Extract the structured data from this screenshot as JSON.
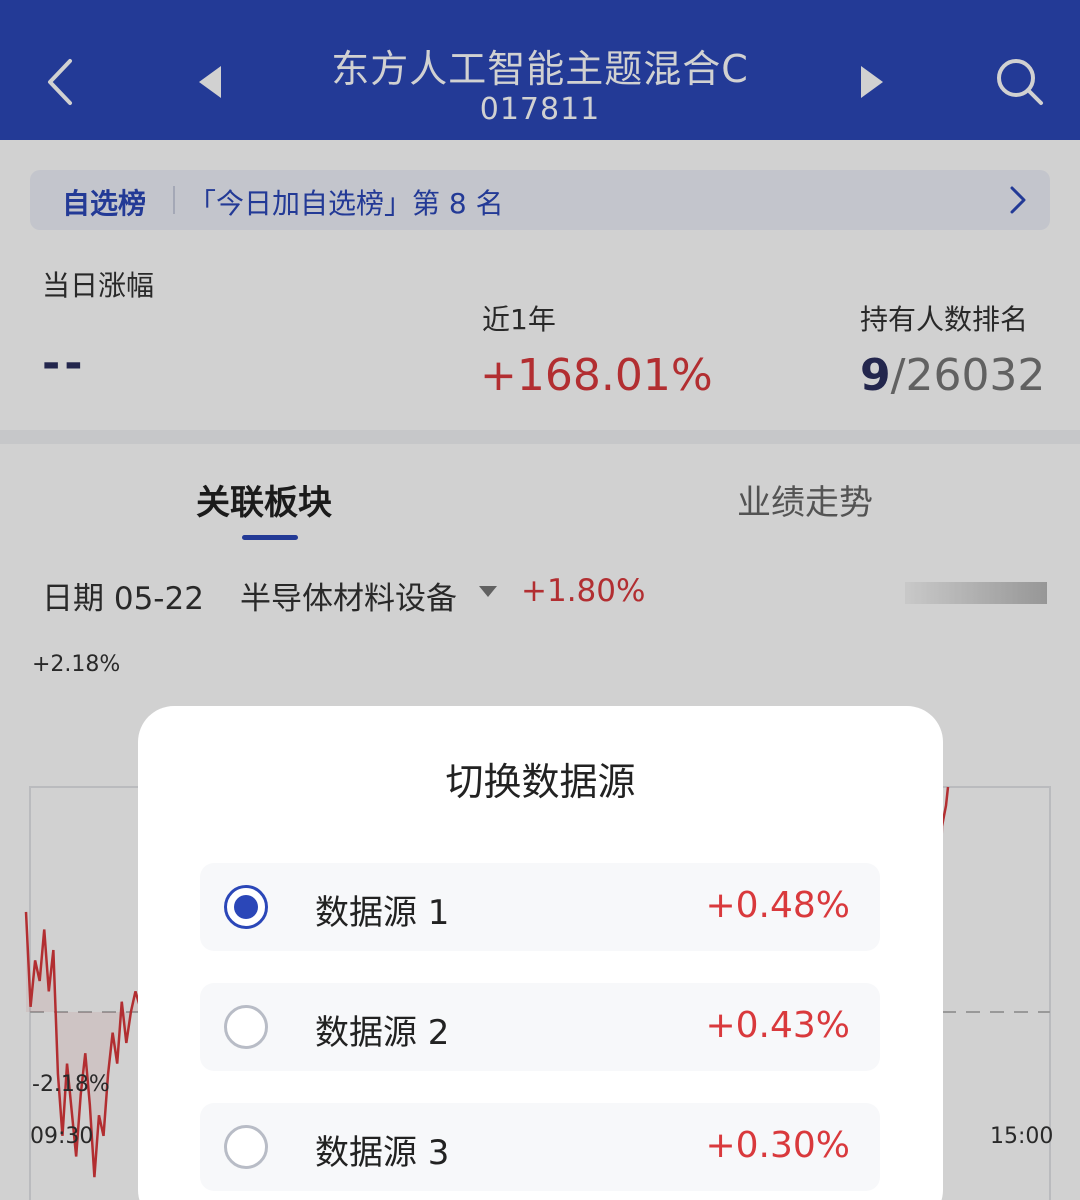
{
  "header": {
    "title": "东方人工智能主题混合C",
    "code": "017811"
  },
  "watchlist": {
    "tag": "自选榜",
    "text": "「今日加自选榜」第 8 名"
  },
  "stats": {
    "daily_label": "当日涨幅",
    "daily_value": "--",
    "year_label": "近1年",
    "year_value": "+168.01%",
    "rank_label": "持有人数排名",
    "rank_value": "9",
    "rank_total": "/26032"
  },
  "tabs": [
    {
      "label": "关联板块",
      "active": true
    },
    {
      "label": "业绩走势",
      "active": false
    }
  ],
  "filter": {
    "date": "日期 05-22",
    "sector": "半导体材料设备",
    "change": "+1.80%"
  },
  "chart_data": {
    "type": "line",
    "y_top_label": "+2.18%",
    "y_bottom_label": "-2.18%",
    "x_start_label": "09:30",
    "x_end_label": "15:00",
    "ylim": [
      -2.18,
      2.18
    ],
    "grid": true,
    "series": [
      {
        "values": [
          0.97,
          0.05,
          0.5,
          0.3,
          0.8,
          0.2,
          0.6,
          -0.6,
          -1.2,
          -0.5,
          -0.95,
          -1.4,
          -0.8,
          -0.4,
          -0.9,
          -1.6,
          -1.0,
          -1.2,
          -0.6,
          -0.2,
          -0.5,
          0.1,
          -0.3,
          0.0,
          0.2,
          0.05
        ],
        "end_values": [
          0.0,
          1.2,
          1.8,
          1.9,
          2.0,
          2.18
        ],
        "color": "#d9393c"
      }
    ]
  },
  "modal": {
    "title": "切换数据源",
    "options": [
      {
        "name": "数据源 1",
        "value": "+0.48%",
        "selected": true
      },
      {
        "name": "数据源 2",
        "value": "+0.43%",
        "selected": false
      },
      {
        "name": "数据源 3",
        "value": "+0.30%",
        "selected": false
      }
    ]
  },
  "colors": {
    "brand": "#2b47b8",
    "up": "#d9393c"
  },
  "icons": {
    "back": "chevron-left-icon",
    "prev": "triangle-left-icon",
    "next": "triangle-right-icon",
    "search": "search-icon",
    "dropdown": "caret-down-icon",
    "watch_arrow": "chevron-right-icon"
  }
}
